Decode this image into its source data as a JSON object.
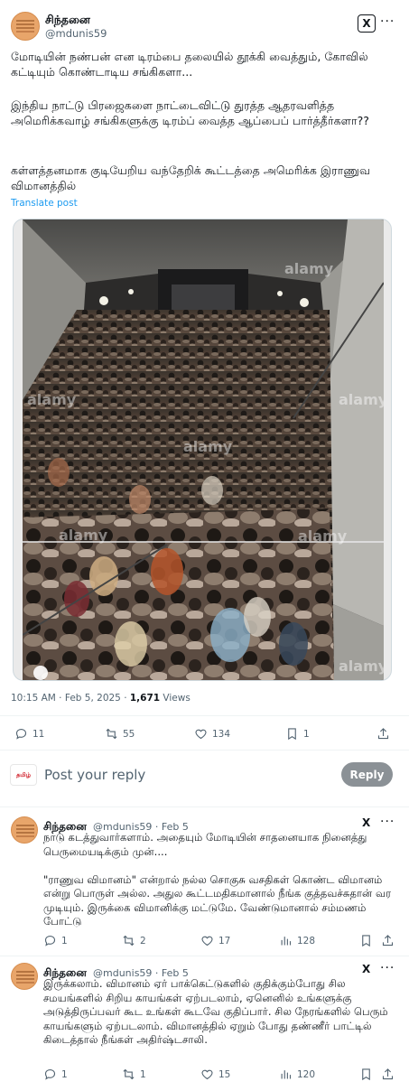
{
  "post": {
    "display_name": "சிந்தனை",
    "handle": "@mdunis59",
    "paragraphs": [
      "மோடியின் நண்பன் என டிரம்பை தலையில் தூக்கி வைத்தும், கோவில் கட்டியும் கொண்டாடிய சங்கிகளா...",
      "இந்திய நாட்டு பிரஜைகளை நாட்டைவிட்டு துரத்த ஆதரவளித்த அமெரிக்கவாழ் சங்கிகளுக்கு டிரம்ப் வைத்த ஆப்பைப் பார்த்தீர்களா??",
      "கள்ளத்தனமாக குடியேறிய வந்தேறிக் கூட்டத்தை அமெரிக்க இராணுவ விமானத்தில்"
    ],
    "translate": "Translate post",
    "photo_watermark": "alamy",
    "time": "10:15 AM · Feb 5, 2025 · ",
    "views_count": "1,671",
    "views_label": " Views",
    "actions": {
      "replies": "11",
      "reposts": "55",
      "likes": "134",
      "bookmarks": "1"
    },
    "badge_text": "X",
    "more": "···"
  },
  "compose": {
    "avatar_text": "தமிழ்",
    "placeholder": "Post your reply",
    "button": "Reply"
  },
  "replies": [
    {
      "display_name": "சிந்தனை",
      "meta": "@mdunis59 · Feb 5",
      "text": "நாடு கடத்துவார்களாம். அதையும் மோடியின் சாதனையாக நினைத்து பெருமையடிக்கும் முன்....\n\n\"ராணுவ விமானம்\" என்றால் நல்ல சொகுசு வசதிகள் கொண்ட விமானம் என்று பொருள் அல்ல. அதுல கூட்டமதிகமானால் நீங்க குத்தவச்சுதான் வர முடியும். இருக்கை விமானிக்கு மட்டுமே. வேண்டுமானால் சம்மணம் போட்டு",
      "actions": {
        "replies": "1",
        "reposts": "2",
        "likes": "17",
        "views": "128"
      }
    },
    {
      "display_name": "சிந்தனை",
      "meta": "@mdunis59 · Feb 5",
      "text": "இருக்கலாம். விமானம் ஏர் பாக்கெட்டுகளில் குதிக்கும்போது சில சமயங்களில் சிறிய காயங்கள் ஏற்படலாம், ஏனெனில் உங்களுக்கு அடுத்திருப்பவர் கூட உங்கள் கூடவே குதிப்பார். சில நேரங்களில் பெரும் காயங்களும் ஏற்படலாம். விமானத்தில் ஏறும் போது தண்ணீர் பாட்டில் கிடைத்தால் நீங்கள் அதிர்ஷ்டசாலி.",
      "actions": {
        "replies": "1",
        "reposts": "1",
        "likes": "15",
        "views": "120"
      }
    }
  ],
  "colors": {
    "link": "#1d9bf0",
    "secondary": "#536471",
    "reply_button": "#8b9196",
    "divider": "#eff3f4"
  },
  "icons": [
    "reply-icon",
    "repost-icon",
    "like-icon",
    "bookmark-icon",
    "share-icon",
    "views-icon",
    "more-icon",
    "x-badge-icon"
  ]
}
